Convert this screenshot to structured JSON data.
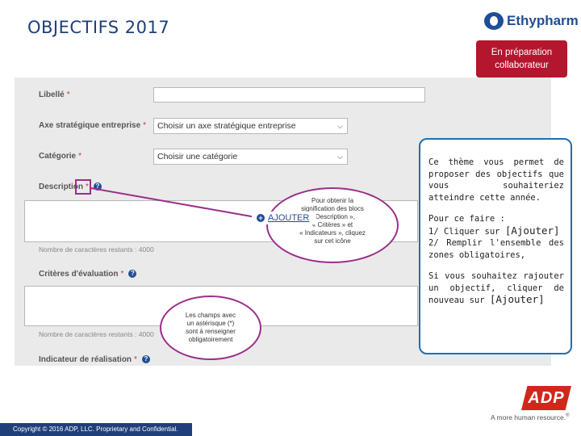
{
  "slide": {
    "title": "OBJECTIFS 2017",
    "company_logo_text": "Ethypharm",
    "status_line1": "En préparation",
    "status_line2": "collaborateur"
  },
  "form": {
    "libelle": {
      "label": "Libellé",
      "required_marker": "*",
      "value": ""
    },
    "axe": {
      "label": "Axe stratégique entreprise",
      "required_marker": "*",
      "selected": "Choisir un axe stratégique entreprise"
    },
    "categorie": {
      "label": "Catégorie",
      "required_marker": "*",
      "selected": "Choisir une catégorie"
    },
    "description": {
      "label": "Description",
      "required_marker": "*",
      "counter": "Nombre de caractères restants : 4000"
    },
    "criteres": {
      "label": "Critères d'évaluation",
      "required_marker": "*",
      "counter": "Nombre de caractères restants : 4000"
    },
    "indicateur": {
      "label": "Indicateur de réalisation",
      "required_marker": "*"
    },
    "help_glyph": "?",
    "add_button": {
      "plus": "+",
      "label": "AJOUTER"
    }
  },
  "callouts": {
    "icon_tip": {
      "line1": "Pour obtenir la",
      "line2": "signification des blocs",
      "line3": "« Description »,",
      "line4": "« Critères » et",
      "line5": "« Indicateurs », cliquez",
      "line6": "sur cet icône"
    },
    "required_tip": {
      "line1": "Les champs avec",
      "line2": "un astérisque (*)",
      "line3": "sont à renseigner",
      "line4": "obligatoirement"
    }
  },
  "info": {
    "p1": "Ce thème vous permet de proposer des objectifs que vous souhaiteriez atteindre cette année.",
    "p2_title": "Pour ce faire :",
    "step1_prefix": "1/ Cliquer sur",
    "step1_button": "[Ajouter]",
    "step2": "2/ Remplir l'ensemble des zones obligatoires,",
    "p3": "Si vous souhaitez rajouter un objectif, cliquer de nouveau sur",
    "p3_button": "[Ajouter]"
  },
  "branding": {
    "adp": "ADP",
    "tagline": "A more human resource.",
    "tagline_mark": "®"
  },
  "footer": {
    "text": "Copyright © 2016 ADP, LLC. Proprietary and Confidential."
  },
  "colors": {
    "title": "#1f3f7a",
    "badge": "#b3162e",
    "callout_border": "#9b2d8a",
    "info_border": "#1e6fb5",
    "adp_red": "#d0271d",
    "footer_bg": "#1f3f7a"
  }
}
